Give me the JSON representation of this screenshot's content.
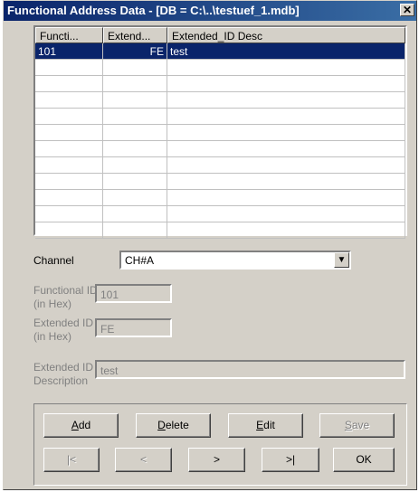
{
  "window": {
    "title": "Functional Address Data - [DB = C:\\..\\testuef_1.mdb]",
    "close_glyph": "✕"
  },
  "grid": {
    "columns": [
      "Functi...",
      "Extend...",
      "Extended_ID Desc"
    ],
    "rows": [
      {
        "functional": "101",
        "extended": "FE",
        "desc": "test",
        "selected": true
      }
    ],
    "empty_rows": 11
  },
  "form": {
    "channel_label": "Channel",
    "channel_value": "CH#A",
    "functional_id_label_1": "Functional ID",
    "functional_id_label_2": "(in Hex)",
    "functional_id_value": "101",
    "extended_id_label_1": "Extended ID",
    "extended_id_label_2": "(in Hex)",
    "extended_id_value": "FE",
    "description_label_1": "Extended ID",
    "description_label_2": "Description",
    "description_value": "test"
  },
  "buttons": {
    "add": {
      "mnemonic": "A",
      "rest": "dd"
    },
    "delete": {
      "mnemonic": "D",
      "rest": "elete"
    },
    "edit": {
      "mnemonic": "E",
      "rest": "dit"
    },
    "save": {
      "mnemonic": "S",
      "rest": "ave"
    },
    "first": "|<",
    "prev": "<",
    "next": ">",
    "last": ">|",
    "ok": "OK"
  },
  "colors": {
    "title_start": "#0a246a",
    "title_end": "#3a6ea5",
    "selection": "#0a246a",
    "face": "#d4d0c8"
  }
}
